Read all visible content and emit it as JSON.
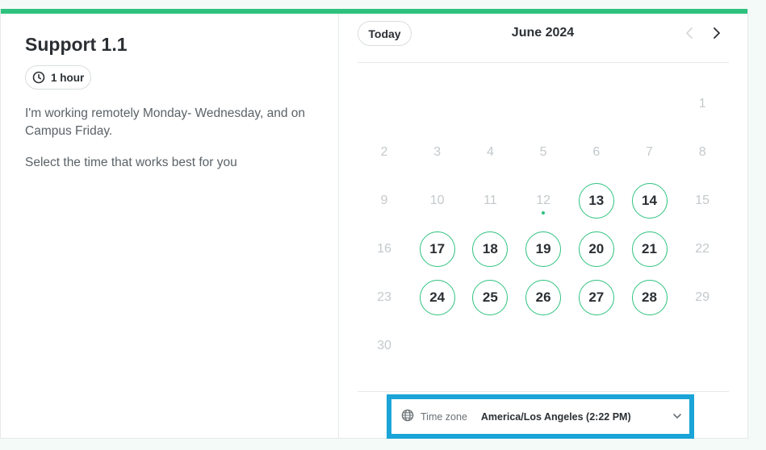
{
  "event": {
    "title": "Support 1.1",
    "duration": "1 hour",
    "description": [
      "I'm working remotely Monday- Wednesday, and on Campus Friday.",
      "Select the time that works best for you"
    ]
  },
  "calendar": {
    "today_label": "Today",
    "month_label": "June 2024",
    "accent_color": "#2ec27e",
    "days": [
      {
        "label": "1",
        "row": 0,
        "col": 6,
        "available": false
      },
      {
        "label": "2",
        "row": 1,
        "col": 0,
        "available": false
      },
      {
        "label": "3",
        "row": 1,
        "col": 1,
        "available": false
      },
      {
        "label": "4",
        "row": 1,
        "col": 2,
        "available": false
      },
      {
        "label": "5",
        "row": 1,
        "col": 3,
        "available": false
      },
      {
        "label": "6",
        "row": 1,
        "col": 4,
        "available": false
      },
      {
        "label": "7",
        "row": 1,
        "col": 5,
        "available": false
      },
      {
        "label": "8",
        "row": 1,
        "col": 6,
        "available": false
      },
      {
        "label": "9",
        "row": 2,
        "col": 0,
        "available": false
      },
      {
        "label": "10",
        "row": 2,
        "col": 1,
        "available": false
      },
      {
        "label": "11",
        "row": 2,
        "col": 2,
        "available": false
      },
      {
        "label": "12",
        "row": 2,
        "col": 3,
        "available": false,
        "today": true
      },
      {
        "label": "13",
        "row": 2,
        "col": 4,
        "available": true
      },
      {
        "label": "14",
        "row": 2,
        "col": 5,
        "available": true
      },
      {
        "label": "15",
        "row": 2,
        "col": 6,
        "available": false
      },
      {
        "label": "16",
        "row": 3,
        "col": 0,
        "available": false
      },
      {
        "label": "17",
        "row": 3,
        "col": 1,
        "available": true
      },
      {
        "label": "18",
        "row": 3,
        "col": 2,
        "available": true
      },
      {
        "label": "19",
        "row": 3,
        "col": 3,
        "available": true
      },
      {
        "label": "20",
        "row": 3,
        "col": 4,
        "available": true
      },
      {
        "label": "21",
        "row": 3,
        "col": 5,
        "available": true
      },
      {
        "label": "22",
        "row": 3,
        "col": 6,
        "available": false
      },
      {
        "label": "23",
        "row": 4,
        "col": 0,
        "available": false
      },
      {
        "label": "24",
        "row": 4,
        "col": 1,
        "available": true
      },
      {
        "label": "25",
        "row": 4,
        "col": 2,
        "available": true
      },
      {
        "label": "26",
        "row": 4,
        "col": 3,
        "available": true
      },
      {
        "label": "27",
        "row": 4,
        "col": 4,
        "available": true
      },
      {
        "label": "28",
        "row": 4,
        "col": 5,
        "available": true
      },
      {
        "label": "29",
        "row": 4,
        "col": 6,
        "available": false
      },
      {
        "label": "30",
        "row": 5,
        "col": 0,
        "available": false
      }
    ]
  },
  "timezone": {
    "label": "Time zone",
    "value": "America/Los Angeles (2:22 PM)",
    "highlight_color": "#1aa4d8"
  }
}
